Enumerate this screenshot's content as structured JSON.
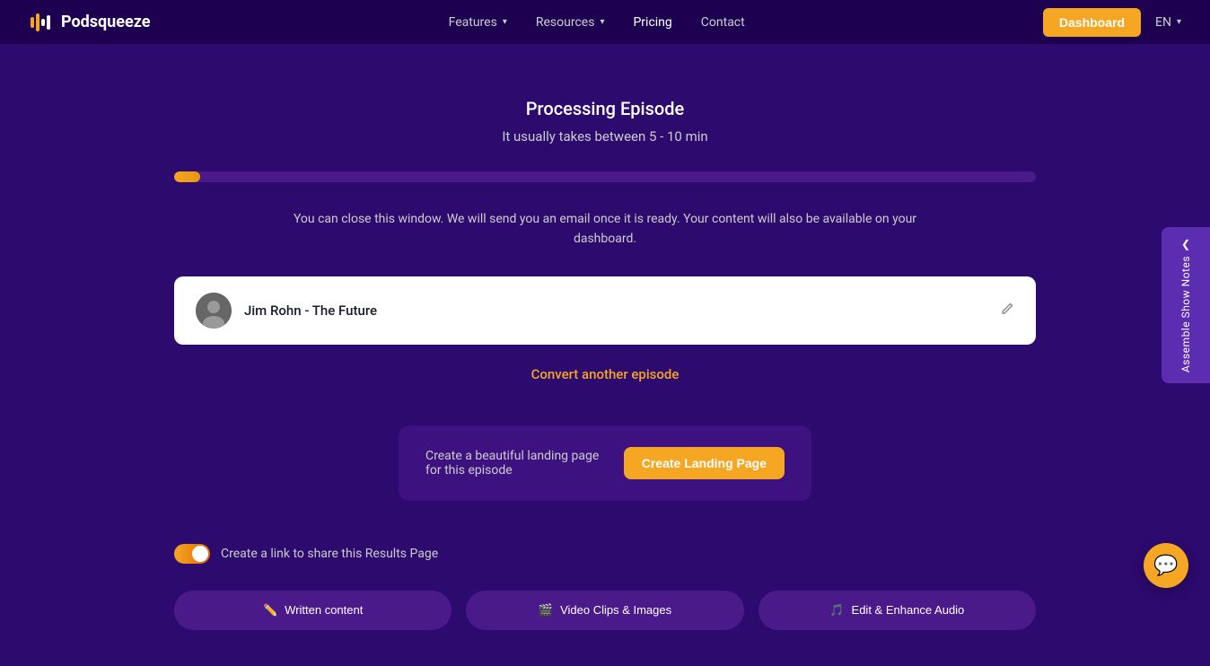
{
  "nav": {
    "logo_text": "Podsqueeze",
    "items": [
      {
        "label": "Features",
        "has_dropdown": true
      },
      {
        "label": "Resources",
        "has_dropdown": true
      },
      {
        "label": "Pricing",
        "has_dropdown": false
      },
      {
        "label": "Contact",
        "has_dropdown": false
      }
    ],
    "dashboard_btn": "Dashboard",
    "lang": "EN"
  },
  "main": {
    "processing_title": "Processing Episode",
    "processing_subtitle": "It usually takes between 5 - 10 min",
    "progress_percent": 3,
    "info_text": "You can close this window. We will send you an email once it is ready. Your content will also be available on your dashboard.",
    "episode_name": "Jim Rohn - The Future",
    "convert_link": "Convert another episode",
    "landing_page_text": "Create a beautiful landing page for this episode",
    "create_landing_btn": "Create Landing Page",
    "share_label": "Create a link to share this Results Page",
    "bottom_buttons": [
      {
        "label": "Written content",
        "icon": "✏️"
      },
      {
        "label": "Video Clips & Images",
        "icon": "🎬"
      },
      {
        "label": "Edit & Enhance Audio",
        "icon": "🎵"
      }
    ]
  },
  "side_panel": {
    "chevron": "❮",
    "text": "Assemble Show Notes"
  },
  "chat": {
    "icon": "💬"
  }
}
